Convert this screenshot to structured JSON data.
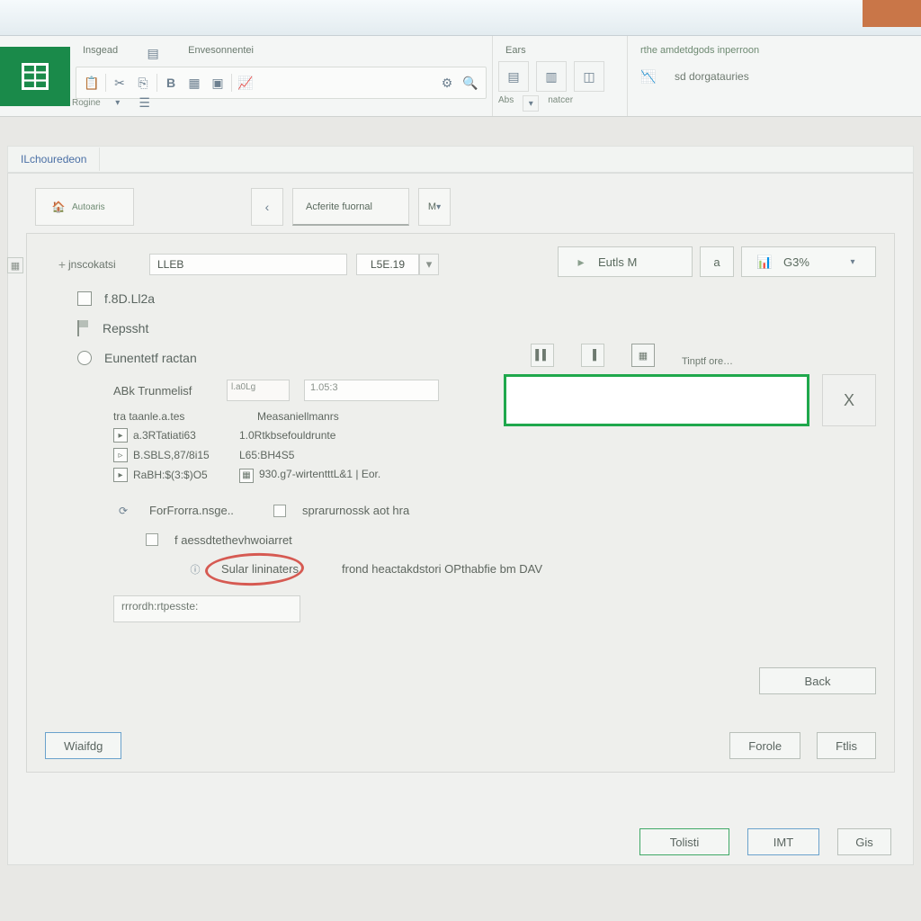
{
  "ribbon": {
    "tabs": {
      "home": "Insgead",
      "insert": "Envesonnentei",
      "data": "Ears",
      "analysis": "rthe amdetdgods inperroon"
    },
    "group_labels": {
      "clipboard": "Rogine",
      "cells": "Abs",
      "editing": "natcer",
      "analysis": "sd dorgatauries"
    }
  },
  "panel": {
    "title": "ILchouredeon",
    "sub_tabs": {
      "main": "Autoaris",
      "format": "Acferite fuornal",
      "m": "M"
    }
  },
  "form": {
    "source_lbl": "jnscokatsi",
    "source_val": "LLEB",
    "code_val": "L5E.19",
    "entities_lbl": "Eutls M",
    "percent_prefix": "a",
    "percent_val": "G3%"
  },
  "options": {
    "opt1": "f.8D.Ll2a",
    "opt2": "Repssht",
    "opt3": "Eunentetf ractan"
  },
  "right_icons": {
    "inspect": "Tinptf ore…"
  },
  "x_label": "X",
  "mid": {
    "abs_lbl": "ABk Trunmelisf",
    "mini_val": "l.a0Lg",
    "long_val": "1.05:3",
    "col1_head": "tra taanle.a.tes",
    "col2_head": "Measaniellmanrs",
    "rows": [
      {
        "a": "a.3RTatiati63",
        "b": "1.0Rtkbsefouldrunte"
      },
      {
        "a": "B.SBLS,87/8i15",
        "b": "L65:BH4S5"
      },
      {
        "a": "RaBH:$(3:$)O5",
        "b": "930.g7-wirtentttL&1 | Eor."
      }
    ]
  },
  "lower": {
    "group1_a": "ForFrorra.nsge..",
    "group1_b": "sprarurnossk aot hra",
    "group2": "f aessdtethevhwoiarret",
    "circled": "Sular lininaters",
    "circled_desc": "frond heactakdstori OPthabfie bm DAV"
  },
  "bottom_input": "rrrordh:rtpesste:",
  "buttons": {
    "back": "Back",
    "waiting": "Wiaifdg",
    "parole": "Forole",
    "files": "Ftlis",
    "total": "Tolisti",
    "init": "IMT",
    "close": "Gis"
  }
}
